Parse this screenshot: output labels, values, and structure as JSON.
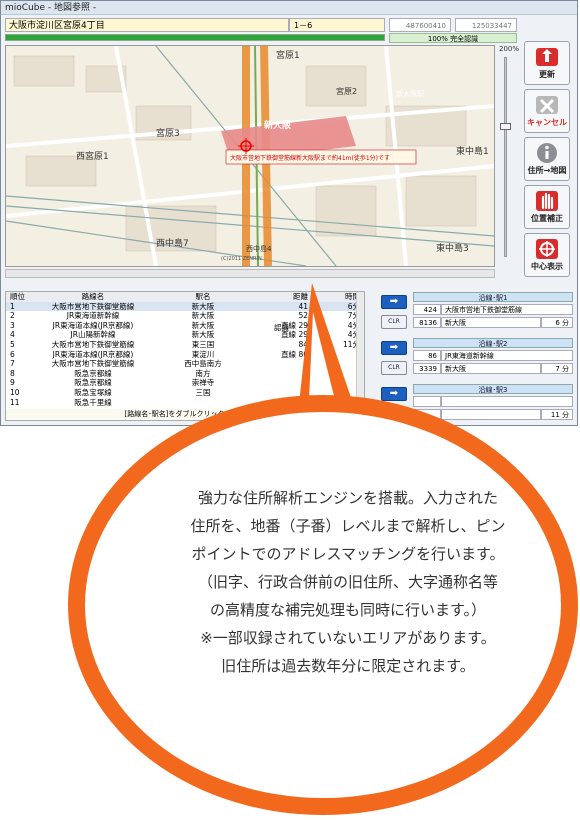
{
  "window": {
    "title": "mioCube - 地図参照 -"
  },
  "address": {
    "text": "大阪市淀川区宮原4丁目",
    "chome": "1－6",
    "coord_x": "487600410",
    "coord_y": "125033447"
  },
  "progress": {
    "percent": 100,
    "label": "100% 完全認識"
  },
  "map": {
    "zoom_label": "200%",
    "labels": [
      "宮原1",
      "宮原3",
      "西宮原1",
      "新大阪",
      "東中島1",
      "東中島3",
      "西中島7",
      "宮原2",
      "新大阪駅",
      "西中島4"
    ],
    "popup": "大阪市営地下鉄御堂筋線新大阪駅まで約41m(徒歩1分)です",
    "copyright": "(C)2011 ZENRIN"
  },
  "side_buttons": [
    {
      "label": "更新",
      "icon": "update-icon",
      "color": "#d92c2c"
    },
    {
      "label": "キャンセル",
      "icon": "cancel-icon",
      "color": "#d92c2c"
    },
    {
      "label": "住所→地図",
      "icon": "info-icon",
      "color": "#222"
    },
    {
      "label": "位置補正",
      "icon": "hand-icon",
      "color": "#222"
    },
    {
      "label": "中心表示",
      "icon": "crosshair-icon",
      "color": "#222"
    }
  ],
  "table": {
    "headers": [
      "順位",
      "路線名",
      "駅名",
      "距離",
      "時間"
    ],
    "rows": [
      [
        "1",
        "大阪市営地下鉄御堂筋線",
        "新大阪",
        "41",
        "6分"
      ],
      [
        "2",
        "JR東海道新幹線",
        "新大阪",
        "52",
        "7分"
      ],
      [
        "3",
        "JR東海道本線(JR京都線)",
        "新大阪",
        "直線 29",
        "4分"
      ],
      [
        "4",
        "JR山陽新幹線",
        "新大阪",
        "直線 29",
        "4分"
      ],
      [
        "5",
        "大阪市営地下鉄御堂筋線",
        "東三国",
        "84",
        "11分"
      ],
      [
        "6",
        "JR東海道本線(JR京都線)",
        "東淀川",
        "直線 80",
        ""
      ],
      [
        "7",
        "大阪市営地下鉄御堂筋線",
        "西中島南方",
        "",
        ""
      ],
      [
        "8",
        "阪急京都線",
        "南方",
        "",
        ""
      ],
      [
        "9",
        "阪急京都線",
        "崇禅寺",
        "",
        ""
      ],
      [
        "10",
        "阪急宝塚線",
        "三国",
        "",
        ""
      ],
      [
        "11",
        "阪急千里線",
        "",
        "",
        ""
      ]
    ],
    "extra_badge": "認識",
    "hint": "[路線名･駅名]をダブルクリックすると"
  },
  "routes": {
    "clr_label": "CLR",
    "arrow_glyph": "➡",
    "entries": [
      {
        "header": "沿線･駅1",
        "code": "424",
        "line": "大阪市営地下鉄御堂筋線",
        "code2": "8136",
        "station": "新大阪",
        "time": "6 分"
      },
      {
        "header": "沿線･駅2",
        "code": "86",
        "line": "JR東海道新幹線",
        "code2": "3339",
        "station": "新大阪",
        "time": "7 分"
      },
      {
        "header": "沿線･駅3",
        "code": "",
        "line": "",
        "code2": "",
        "station": "",
        "time": "11 分"
      }
    ]
  },
  "bubble": {
    "lines": [
      "強力な住所解析エンジンを搭載。入力された",
      "住所を、地番（子番）レベルまで解析し、ピン",
      "ポイントでのアドレスマッチングを行います。",
      "（旧字、行政合併前の旧住所、大字通称名等",
      "の高精度な補完処理も同時に行います。）",
      "※一部収録されていないエリアがあります。",
      "旧住所は過去数年分に限定されます。"
    ]
  }
}
